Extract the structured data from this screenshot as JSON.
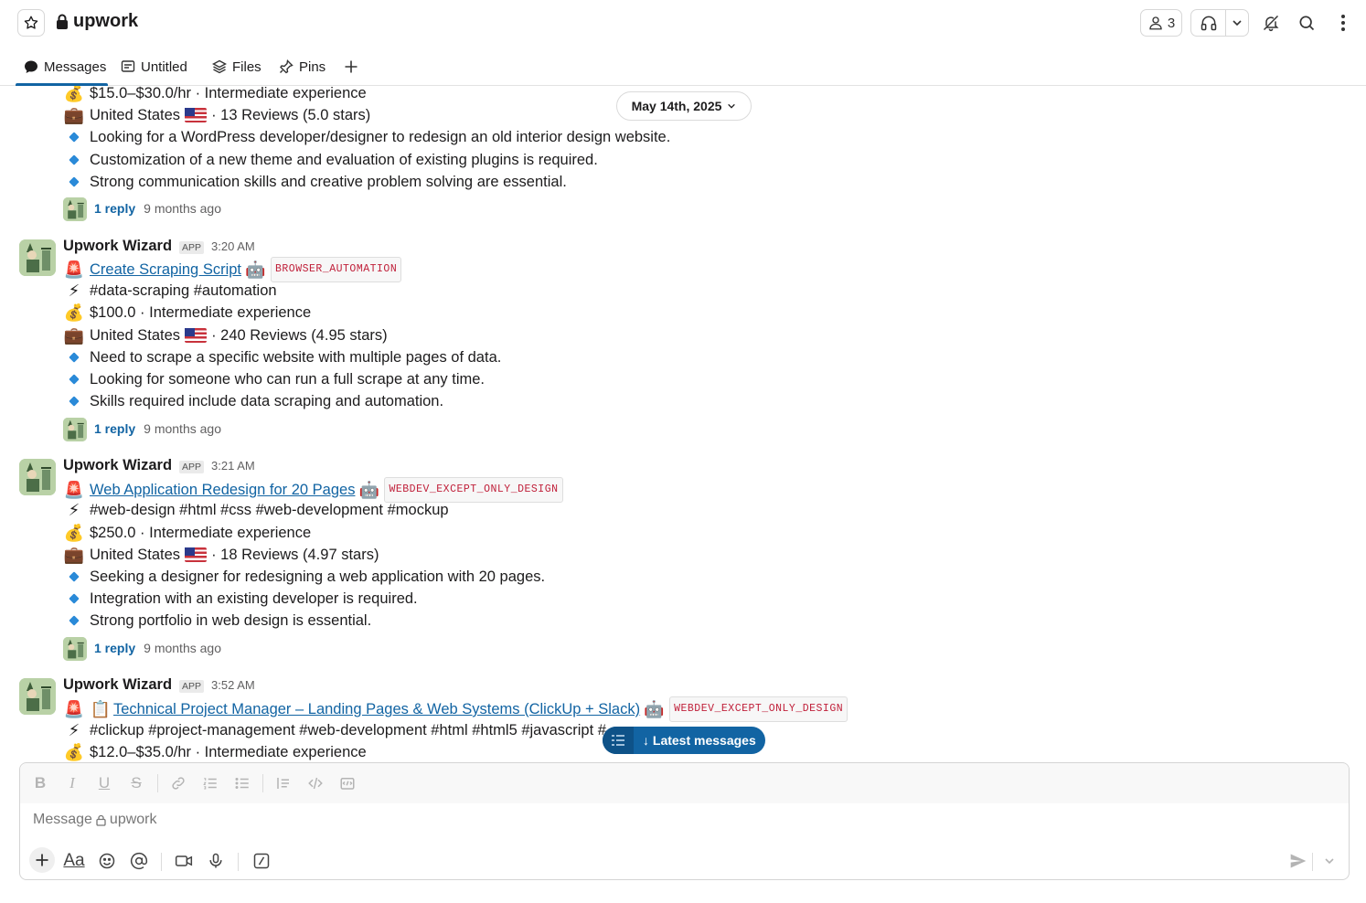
{
  "header": {
    "channel_name": "upwork",
    "member_count": "3"
  },
  "tabs": [
    {
      "label": "Messages"
    },
    {
      "label": "Untitled"
    },
    {
      "label": "Files"
    },
    {
      "label": "Pins"
    }
  ],
  "date_divider": "May 14th, 2025",
  "top_partial": {
    "rate": "$15.0–$30.0/hr · Intermediate experience",
    "client_country": "United States",
    "client_reviews": "· 13 Reviews (5.0 stars)",
    "bullets": [
      "Looking for a WordPress developer/designer to redesign an old interior design website.",
      "Customization of a new theme and evaluation of existing plugins is required.",
      "Strong communication skills and creative problem solving are essential."
    ],
    "reply_count": "1 reply",
    "reply_ago": "9 months ago"
  },
  "messages": [
    {
      "author": "Upwork Wizard",
      "badge": "APP",
      "time": "3:20 AM",
      "title": "Create Scraping Script",
      "tag": "BROWSER_AUTOMATION",
      "hashtags": "#data-scraping #automation",
      "rate": "$100.0 · Intermediate experience",
      "client_country": "United States",
      "client_reviews": "· 240 Reviews (4.95 stars)",
      "bullets": [
        "Need to scrape a specific website with multiple pages of data.",
        "Looking for someone who can run a full scrape at any time.",
        "Skills required include data scraping and automation."
      ],
      "reply_count": "1 reply",
      "reply_ago": "9 months ago"
    },
    {
      "author": "Upwork Wizard",
      "badge": "APP",
      "time": "3:21 AM",
      "title": "Web Application Redesign for 20 Pages",
      "tag": "WEBDEV_EXCEPT_ONLY_DESIGN",
      "hashtags": "#web-design #html #css #web-development #mockup",
      "rate": "$250.0 · Intermediate experience",
      "client_country": "United States",
      "client_reviews": "· 18 Reviews (4.97 stars)",
      "bullets": [
        "Seeking a designer for redesigning a web application with 20 pages.",
        "Integration with an existing developer is required.",
        "Strong portfolio in web design is essential."
      ],
      "reply_count": "1 reply",
      "reply_ago": "9 months ago"
    },
    {
      "author": "Upwork Wizard",
      "badge": "APP",
      "time": "3:52 AM",
      "title": "Technical Project Manager – Landing Pages & Web Systems (ClickUp + Slack)",
      "tag": "WEBDEV_EXCEPT_ONLY_DESIGN",
      "hashtags": "#clickup #project-management #web-development #html #html5 #javascript #",
      "rate": "$12.0–$35.0/hr · Intermediate experience"
    }
  ],
  "latest_messages_label": "↓ Latest messages",
  "composer": {
    "placeholder_prefix": "Message",
    "placeholder_channel": "upwork"
  }
}
